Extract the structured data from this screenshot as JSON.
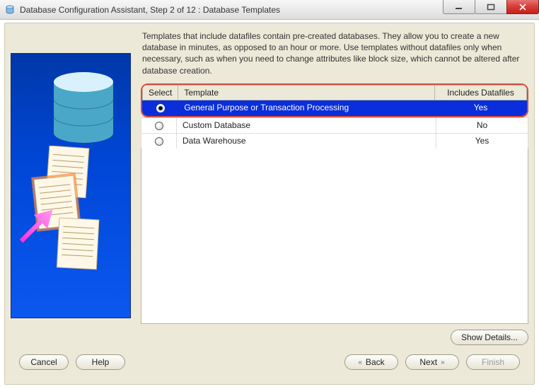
{
  "window": {
    "title": "Database Configuration Assistant, Step 2 of 12 : Database Templates"
  },
  "description": "Templates that include datafiles contain pre-created databases. They allow you to create a new database in minutes, as opposed to an hour or more. Use templates without datafiles only when necessary, such as when you need to change attributes like block size, which cannot be altered after database creation.",
  "table": {
    "headers": {
      "select": "Select",
      "template": "Template",
      "includes": "Includes Datafiles"
    },
    "rows": [
      {
        "template": "General Purpose or Transaction Processing",
        "includes": "Yes",
        "selected": true
      },
      {
        "template": "Custom Database",
        "includes": "No",
        "selected": false
      },
      {
        "template": "Data Warehouse",
        "includes": "Yes",
        "selected": false
      }
    ]
  },
  "buttons": {
    "show_details": "Show Details...",
    "cancel": "Cancel",
    "help": "Help",
    "back": "Back",
    "next": "Next",
    "finish": "Finish"
  }
}
